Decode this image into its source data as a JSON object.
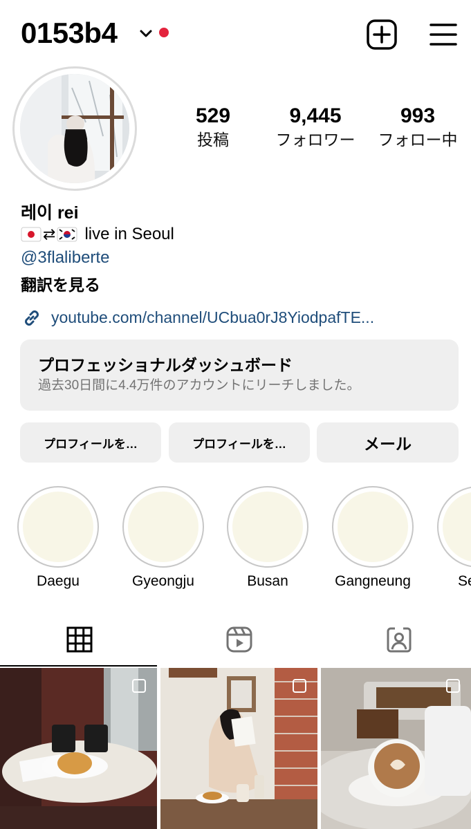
{
  "header": {
    "username": "0153b4"
  },
  "stats": [
    {
      "value": "529",
      "label": "投稿"
    },
    {
      "value": "9,445",
      "label": "フォロワー"
    },
    {
      "value": "993",
      "label": "フォロー中"
    }
  ],
  "bio": {
    "name": "레이 rei",
    "line": "live in Seoul",
    "mention": "@3flaliberte",
    "translate": "翻訳を見る",
    "link": "youtube.com/channel/UCbua0rJ8YiodpafTE..."
  },
  "dashboard": {
    "title": "プロフェッショナルダッシュボード",
    "subtitle": "過去30日間に4.4万件のアカウントにリーチしました。"
  },
  "buttons": [
    "プロフィールを…",
    "プロフィールを…",
    "メール"
  ],
  "highlights": [
    "Daegu",
    "Gyeongju",
    "Busan",
    "Gangneung",
    "Se"
  ],
  "tabs": [
    "grid-icon",
    "reels-icon",
    "tagged-icon"
  ],
  "colors": {
    "accent_dot": "#e3233d",
    "link": "#1f4d7a",
    "button_bg": "#efefef",
    "highlight_fill": "#f8f6e7"
  }
}
